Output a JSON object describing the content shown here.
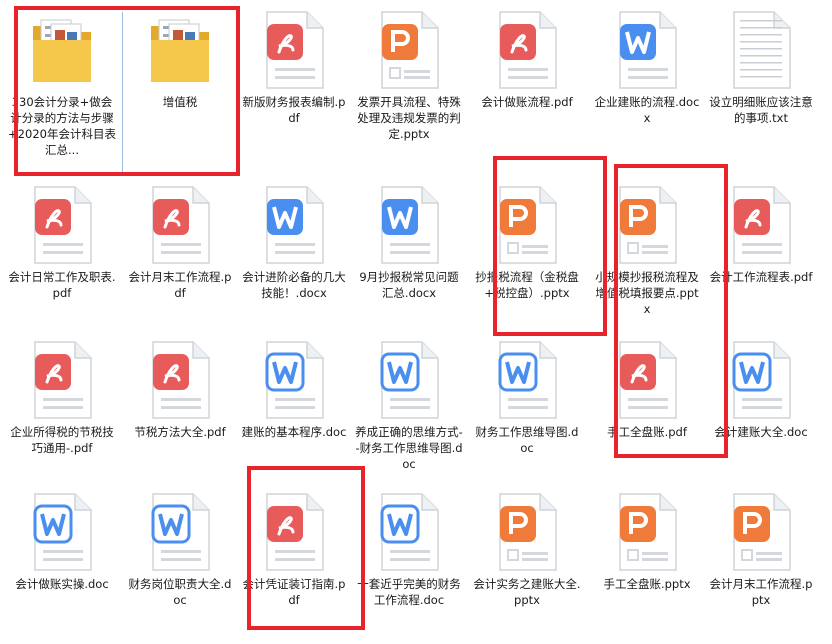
{
  "colors": {
    "pdf": "#e85b5b",
    "pptx": "#f07a3a",
    "docx": "#4a8ef0",
    "folder": "#f5c84c",
    "highlight": "#e8232b"
  },
  "files": [
    {
      "label": "330会计分录+做会计分录的方法与步骤+2020年会计科目表汇总...",
      "type": "folder",
      "icon": "folder-icon"
    },
    {
      "label": "增值税",
      "type": "folder",
      "icon": "folder-icon"
    },
    {
      "label": "新版财务报表编制.pdf",
      "type": "pdf",
      "icon": "pdf-file-icon"
    },
    {
      "label": "发票开具流程、特殊处理及违规发票的判定.pptx",
      "type": "pptx",
      "icon": "pptx-file-icon"
    },
    {
      "label": "会计做账流程.pdf",
      "type": "pdf",
      "icon": "pdf-file-icon"
    },
    {
      "label": "企业建账的流程.docx",
      "type": "docx",
      "icon": "docx-file-icon"
    },
    {
      "label": "设立明细账应该注意的事项.txt",
      "type": "txt",
      "icon": "txt-file-icon"
    },
    {
      "label": "会计日常工作及职表.pdf",
      "type": "pdf",
      "icon": "pdf-file-icon"
    },
    {
      "label": "会计月末工作流程.pdf",
      "type": "pdf",
      "icon": "pdf-file-icon"
    },
    {
      "label": "会计进阶必备的几大技能！.docx",
      "type": "docx",
      "icon": "docx-file-icon"
    },
    {
      "label": "9月抄报税常见问题汇总.docx",
      "type": "docx",
      "icon": "docx-file-icon"
    },
    {
      "label": "抄报税流程（金税盘+税控盘）.pptx",
      "type": "pptx",
      "icon": "pptx-file-icon"
    },
    {
      "label": "小规模抄报税流程及增值税填报要点.pptx",
      "type": "pptx",
      "icon": "pptx-file-icon"
    },
    {
      "label": "会计工作流程表.pdf",
      "type": "pdf",
      "icon": "pdf-file-icon"
    },
    {
      "label": "企业所得税的节税技巧通用-.pdf",
      "type": "pdf",
      "icon": "pdf-file-icon"
    },
    {
      "label": "节税方法大全.pdf",
      "type": "pdf",
      "icon": "pdf-file-icon"
    },
    {
      "label": "建账的基本程序.doc",
      "type": "doc",
      "icon": "doc-file-icon"
    },
    {
      "label": "养成正确的思维方式--财务工作思维导图.doc",
      "type": "doc",
      "icon": "doc-file-icon"
    },
    {
      "label": "财务工作思维导图.doc",
      "type": "doc",
      "icon": "doc-file-icon"
    },
    {
      "label": "手工全盘账.pdf",
      "type": "pdf",
      "icon": "pdf-file-icon"
    },
    {
      "label": "会计建账大全.doc",
      "type": "doc",
      "icon": "doc-file-icon"
    },
    {
      "label": "会计做账实操.doc",
      "type": "doc",
      "icon": "doc-file-icon"
    },
    {
      "label": "财务岗位职责大全.doc",
      "type": "doc",
      "icon": "doc-file-icon"
    },
    {
      "label": "会计凭证装订指南.pdf",
      "type": "pdf",
      "icon": "pdf-file-icon"
    },
    {
      "label": "一套近乎完美的财务工作流程.doc",
      "type": "doc",
      "icon": "doc-file-icon"
    },
    {
      "label": "会计实务之建账大全.pptx",
      "type": "pptx",
      "icon": "pptx-file-icon"
    },
    {
      "label": "手工全盘账.pptx",
      "type": "pptx",
      "icon": "pptx-file-icon"
    },
    {
      "label": "会计月末工作流程.pptx",
      "type": "pptx",
      "icon": "pptx-file-icon"
    }
  ]
}
